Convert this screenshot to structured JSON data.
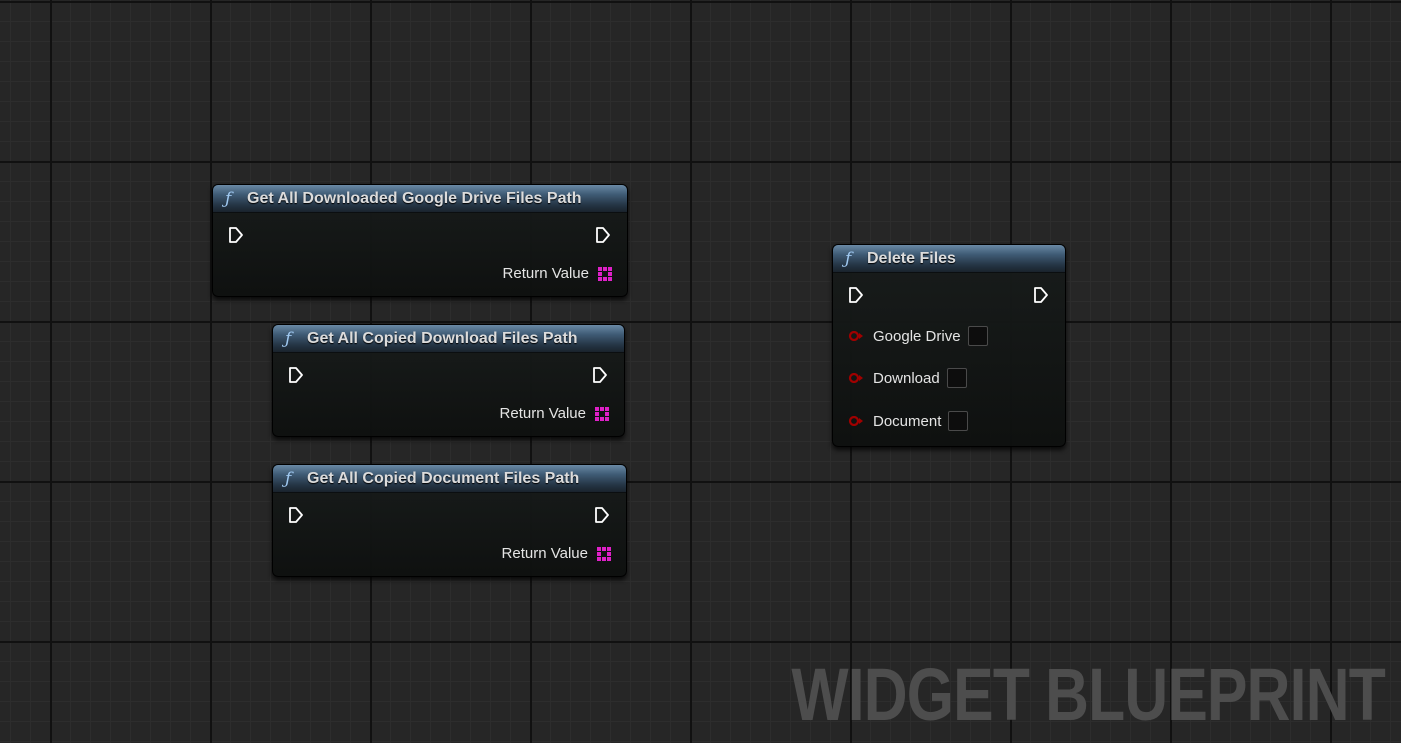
{
  "graph": {
    "watermark": "WIDGET BLUEPRINT"
  },
  "nodes": [
    {
      "title": "Get All Downloaded Google Drive Files Path",
      "icon": "function-icon",
      "outputs": [
        "Return Value"
      ]
    },
    {
      "title": "Get All Copied Download Files Path",
      "icon": "function-icon",
      "outputs": [
        "Return Value"
      ]
    },
    {
      "title": "Get All Copied Document Files Path",
      "icon": "function-icon",
      "outputs": [
        "Return Value"
      ]
    },
    {
      "title": "Delete Files",
      "icon": "function-icon",
      "inputs": [
        {
          "label": "Google Drive",
          "checked": false
        },
        {
          "label": "Download",
          "checked": false
        },
        {
          "label": "Document",
          "checked": false
        }
      ]
    }
  ],
  "colors": {
    "header": "#3f5b75",
    "bool_pin": "#8c0000",
    "array_pin": "#e020c8",
    "exec_pin": "#ffffff"
  }
}
